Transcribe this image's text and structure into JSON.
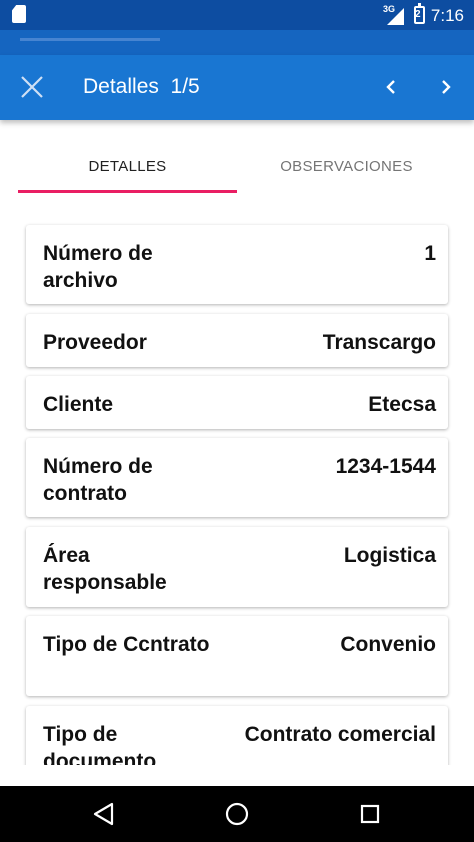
{
  "status_bar": {
    "network": "3G",
    "battery_level": "2",
    "time": "7:16",
    "icons": [
      "sd-card-icon",
      "signal-icon",
      "battery-icon"
    ]
  },
  "toolbar": {
    "title": "Detalles  1/5",
    "close_icon": "close-icon",
    "prev_icon": "chevron-left-icon",
    "next_icon": "chevron-right-icon",
    "color": "#1976d2"
  },
  "tabs": [
    {
      "label": "DETALLES",
      "active": true
    },
    {
      "label": "OBSERVACIONES",
      "active": false
    }
  ],
  "tab_indicator_color": "#e91e63",
  "details": [
    {
      "label": "Número de archivo",
      "value": "1"
    },
    {
      "label": "Proveedor",
      "value": "Transcargo"
    },
    {
      "label": "Cliente",
      "value": "Etecsa"
    },
    {
      "label": "Número de contrato",
      "value": "1234-1544"
    },
    {
      "label": "Área responsable",
      "value": "Logistica"
    },
    {
      "label": "Tipo de Ccntrato",
      "value": "Convenio"
    },
    {
      "label": "Tipo de documento",
      "value": "Contrato comercial"
    }
  ],
  "nav_bar": {
    "back_icon": "back-triangle-icon",
    "home_icon": "home-circle-icon",
    "recents_icon": "recents-square-icon"
  }
}
